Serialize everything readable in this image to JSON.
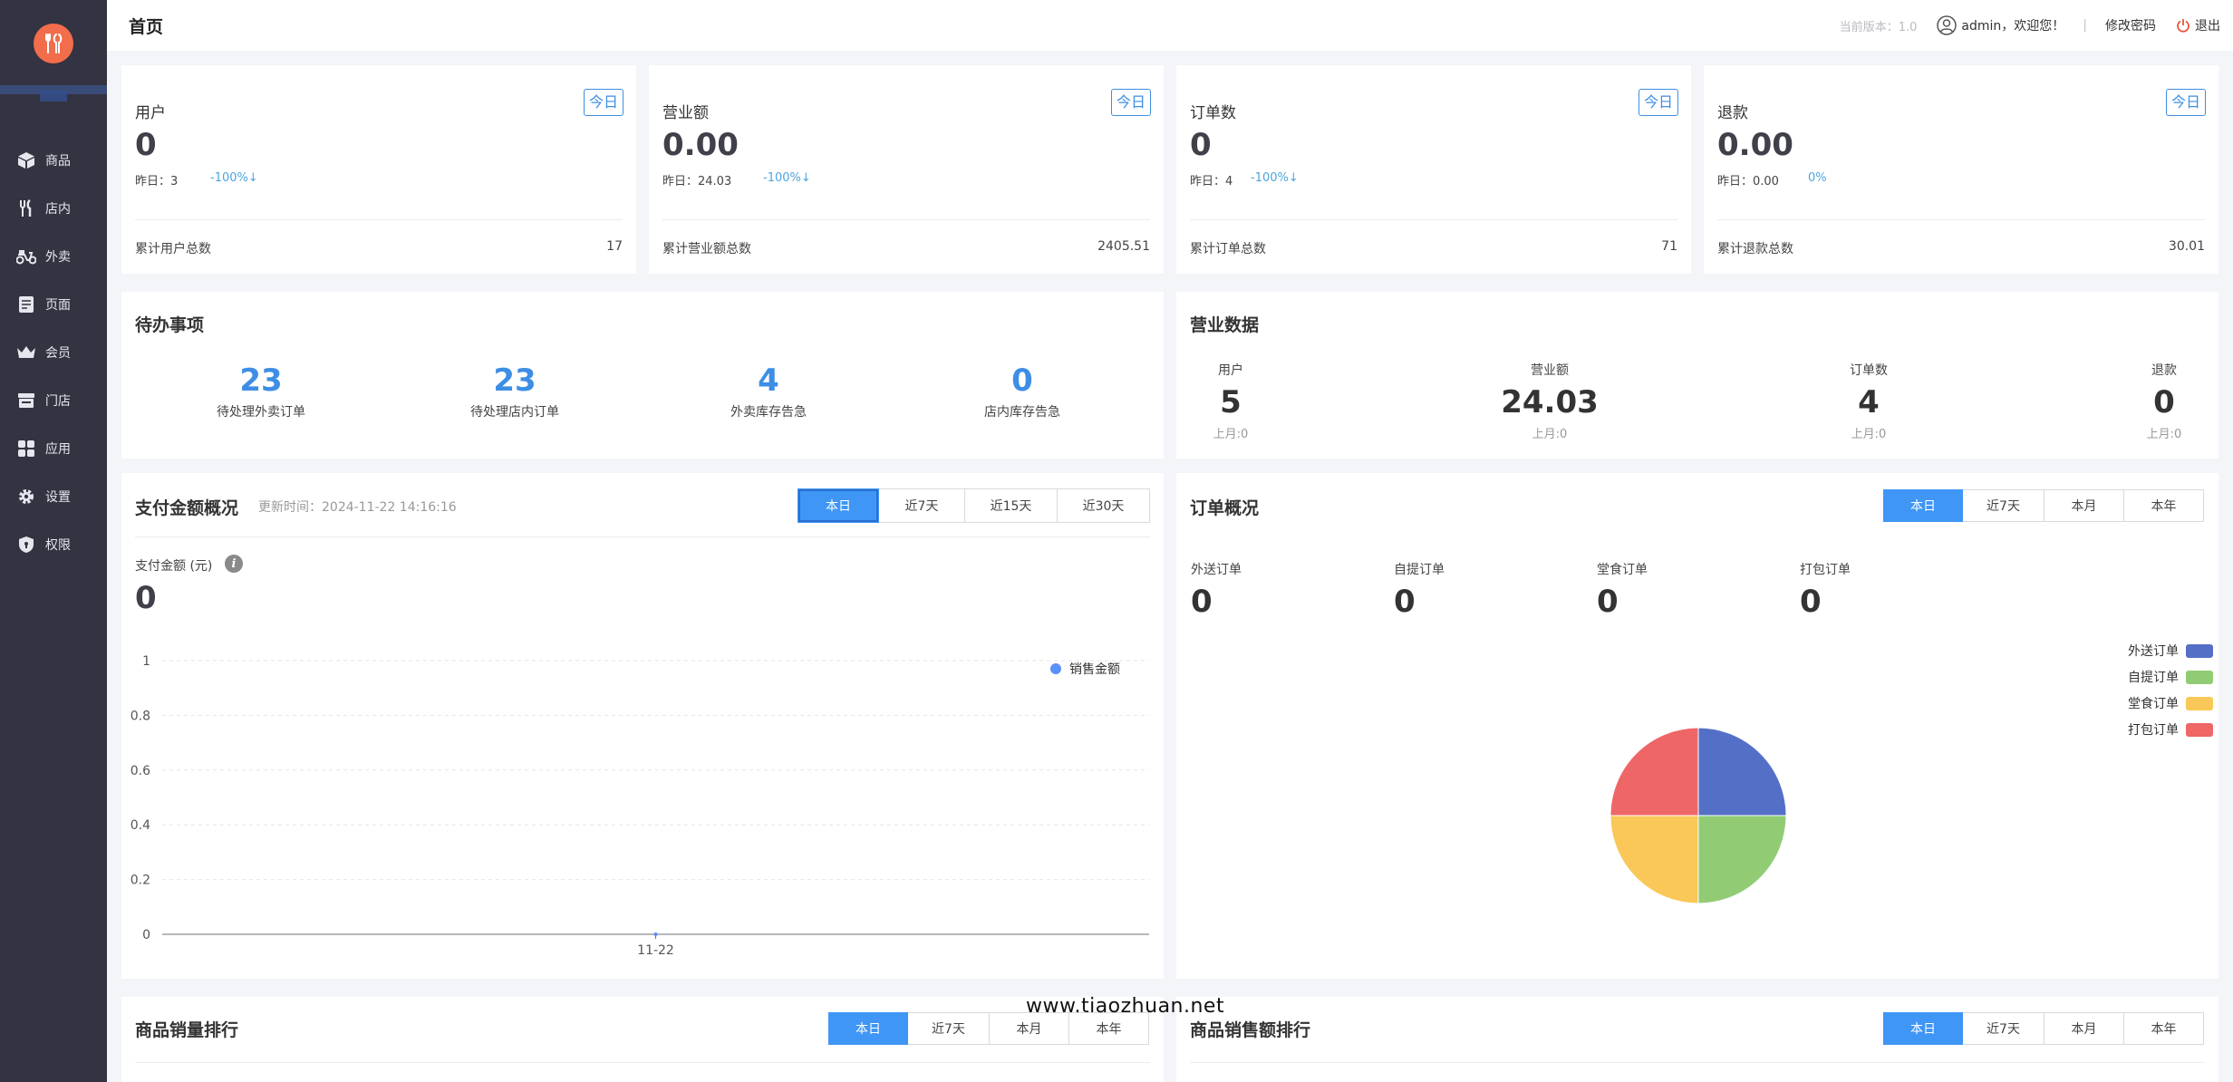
{
  "topbar": {
    "title": "首页",
    "version": "当前版本：1.0",
    "user": "admin，欢迎您！",
    "sep": "|",
    "change_password": "修改密码",
    "logout": "退出"
  },
  "sidebar": {
    "items": [
      {
        "label": "商品",
        "icon": "box-icon"
      },
      {
        "label": "店内",
        "icon": "fork-knife-icon"
      },
      {
        "label": "外卖",
        "icon": "scooter-icon"
      },
      {
        "label": "页面",
        "icon": "page-icon"
      },
      {
        "label": "会员",
        "icon": "crown-icon"
      },
      {
        "label": "门店",
        "icon": "store-icon"
      },
      {
        "label": "应用",
        "icon": "apps-icon"
      },
      {
        "label": "设置",
        "icon": "gear-icon"
      },
      {
        "label": "权限",
        "icon": "shield-icon"
      }
    ]
  },
  "stats": [
    {
      "label": "用户",
      "badge": "今日",
      "value": "0",
      "yesterday": "昨日：3",
      "pct": "-100%↓",
      "total_label": "累计用户总数",
      "total": "17"
    },
    {
      "label": "营业额",
      "badge": "今日",
      "value": "0.00",
      "yesterday": "昨日：24.03",
      "pct": "-100%↓",
      "total_label": "累计营业额总数",
      "total": "2405.51"
    },
    {
      "label": "订单数",
      "badge": "今日",
      "value": "0",
      "yesterday": "昨日：4",
      "pct": "-100%↓",
      "total_label": "累计订单总数",
      "total": "71"
    },
    {
      "label": "退款",
      "badge": "今日",
      "value": "0.00",
      "yesterday": "昨日：0.00",
      "pct": "0%",
      "total_label": "累计退款总数",
      "total": "30.01"
    }
  ],
  "todo": {
    "title": "待办事项",
    "items": [
      {
        "value": "23",
        "label": "待处理外卖订单"
      },
      {
        "value": "23",
        "label": "待处理店内订单"
      },
      {
        "value": "4",
        "label": "外卖库存告急"
      },
      {
        "value": "0",
        "label": "店内库存告急"
      }
    ]
  },
  "business": {
    "title": "营业数据",
    "items": [
      {
        "label": "用户",
        "value": "5",
        "sub": "上月:0"
      },
      {
        "label": "营业额",
        "value": "24.03",
        "sub": "上月:0"
      },
      {
        "label": "订单数",
        "value": "4",
        "sub": "上月:0"
      },
      {
        "label": "退款",
        "value": "0",
        "sub": "上月:0"
      }
    ]
  },
  "payment": {
    "title": "支付金额概况",
    "updated": "更新时间：2024-11-22 14:16:16",
    "tabs": [
      "本日",
      "近7天",
      "近15天",
      "近30天"
    ],
    "metric_label": "支付金额 (元)",
    "info_icon": "info-icon",
    "metric_value": "0"
  },
  "orders": {
    "title": "订单概况",
    "tabs": [
      "本日",
      "近7天",
      "本月",
      "本年"
    ],
    "items": [
      {
        "label": "外送订单",
        "value": "0"
      },
      {
        "label": "自提订单",
        "value": "0"
      },
      {
        "label": "堂食订单",
        "value": "0"
      },
      {
        "label": "打包订单",
        "value": "0"
      }
    ]
  },
  "product_sales": {
    "title": "商品销量排行",
    "tabs": [
      "本日",
      "近7天",
      "本月",
      "本年"
    ]
  },
  "product_revenue": {
    "title": "商品销售额排行",
    "tabs": [
      "本日",
      "近7天",
      "本月",
      "本年"
    ]
  },
  "watermark": "www.tiaozhuan.net",
  "colors": {
    "sidebar": "#343342",
    "accent": "#3f96f5",
    "logo": "#f26d4b"
  },
  "chart_data": [
    {
      "type": "line",
      "x": [
        "11-22"
      ],
      "series": [
        {
          "name": "销售金额",
          "values": [
            0
          ],
          "color": "#5b8ff9"
        }
      ],
      "yticks": [
        "0",
        "0.2",
        "0.4",
        "0.6",
        "0.8",
        "1"
      ],
      "ylim": [
        0,
        1
      ],
      "grid": true,
      "legend": "top-right"
    },
    {
      "type": "pie",
      "categories": [
        "外送订单",
        "自提订单",
        "堂食订单",
        "打包订单"
      ],
      "values": [
        25,
        25,
        25,
        25
      ],
      "colors": [
        "#5470c6",
        "#91cc75",
        "#fac858",
        "#ee6666"
      ],
      "legend": "top-right"
    }
  ]
}
